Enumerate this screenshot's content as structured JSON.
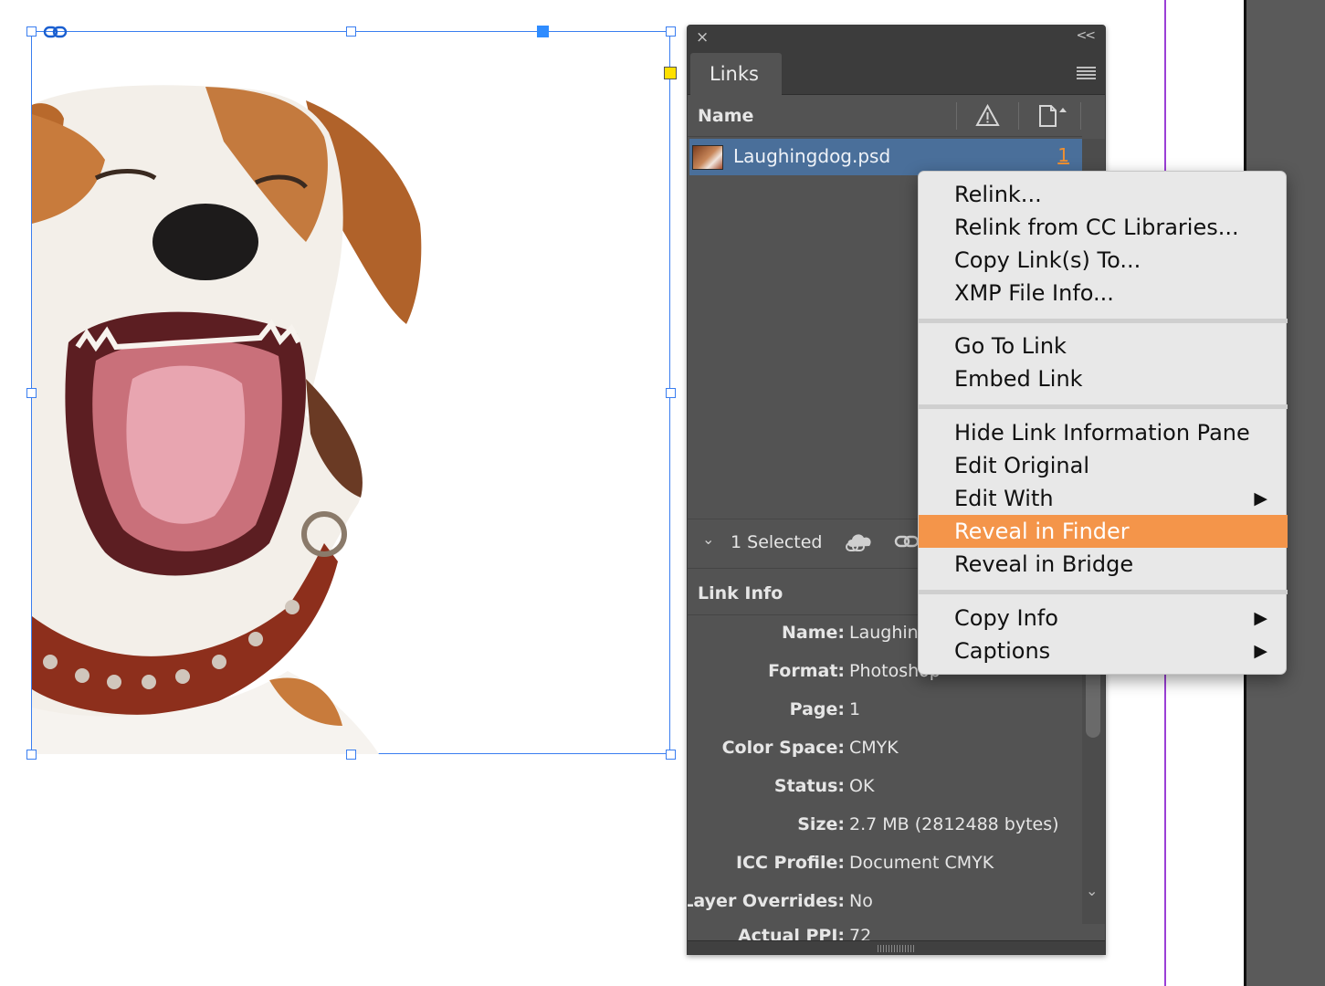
{
  "panel": {
    "tab_label": "Links",
    "column_header_name": "Name",
    "collapse_label": "<<",
    "close_glyph": "×"
  },
  "link": {
    "filename": "Laughingdog.psd",
    "page": "1"
  },
  "selection": {
    "count_label": "1 Selected"
  },
  "link_info": {
    "title": "Link Info",
    "rows": [
      {
        "label": "Name:",
        "value": "Laughin"
      },
      {
        "label": "Format:",
        "value": "Photoshop"
      },
      {
        "label": "Page:",
        "value": "1"
      },
      {
        "label": "Color Space:",
        "value": "CMYK"
      },
      {
        "label": "Status:",
        "value": "OK"
      },
      {
        "label": "Size:",
        "value": "2.7 MB (2812488 bytes)"
      },
      {
        "label": "ICC Profile:",
        "value": "Document CMYK"
      },
      {
        "label": "Layer Overrides:",
        "value": "No"
      },
      {
        "label": "Actual PPI:",
        "value": "72"
      }
    ]
  },
  "context_menu": {
    "groups": [
      [
        "Relink...",
        "Relink from CC Libraries...",
        "Copy Link(s) To...",
        "XMP File Info..."
      ],
      [
        "Go To Link",
        "Embed Link"
      ],
      [
        "Hide Link Information Pane",
        "Edit Original",
        "Edit With",
        "Reveal in Finder",
        "Reveal in Bridge"
      ],
      [
        "Copy Info",
        "Captions"
      ]
    ],
    "highlighted": "Reveal in Finder",
    "submenu_items": [
      "Edit With",
      "Copy Info",
      "Captions"
    ]
  },
  "colors": {
    "panel_bg": "#535353",
    "selected_row": "#4a6f9a",
    "menu_highlight": "#f4954a",
    "frame_stroke": "#3a7ef0",
    "margin_guide": "#9b3fd6"
  },
  "icons": [
    "close-icon",
    "collapse-icon",
    "panel-menu-icon",
    "warning-icon",
    "page-icon",
    "chevron-down-icon",
    "cloud-link-icon",
    "relink-icon",
    "link-badge-icon",
    "submenu-arrow-icon"
  ]
}
